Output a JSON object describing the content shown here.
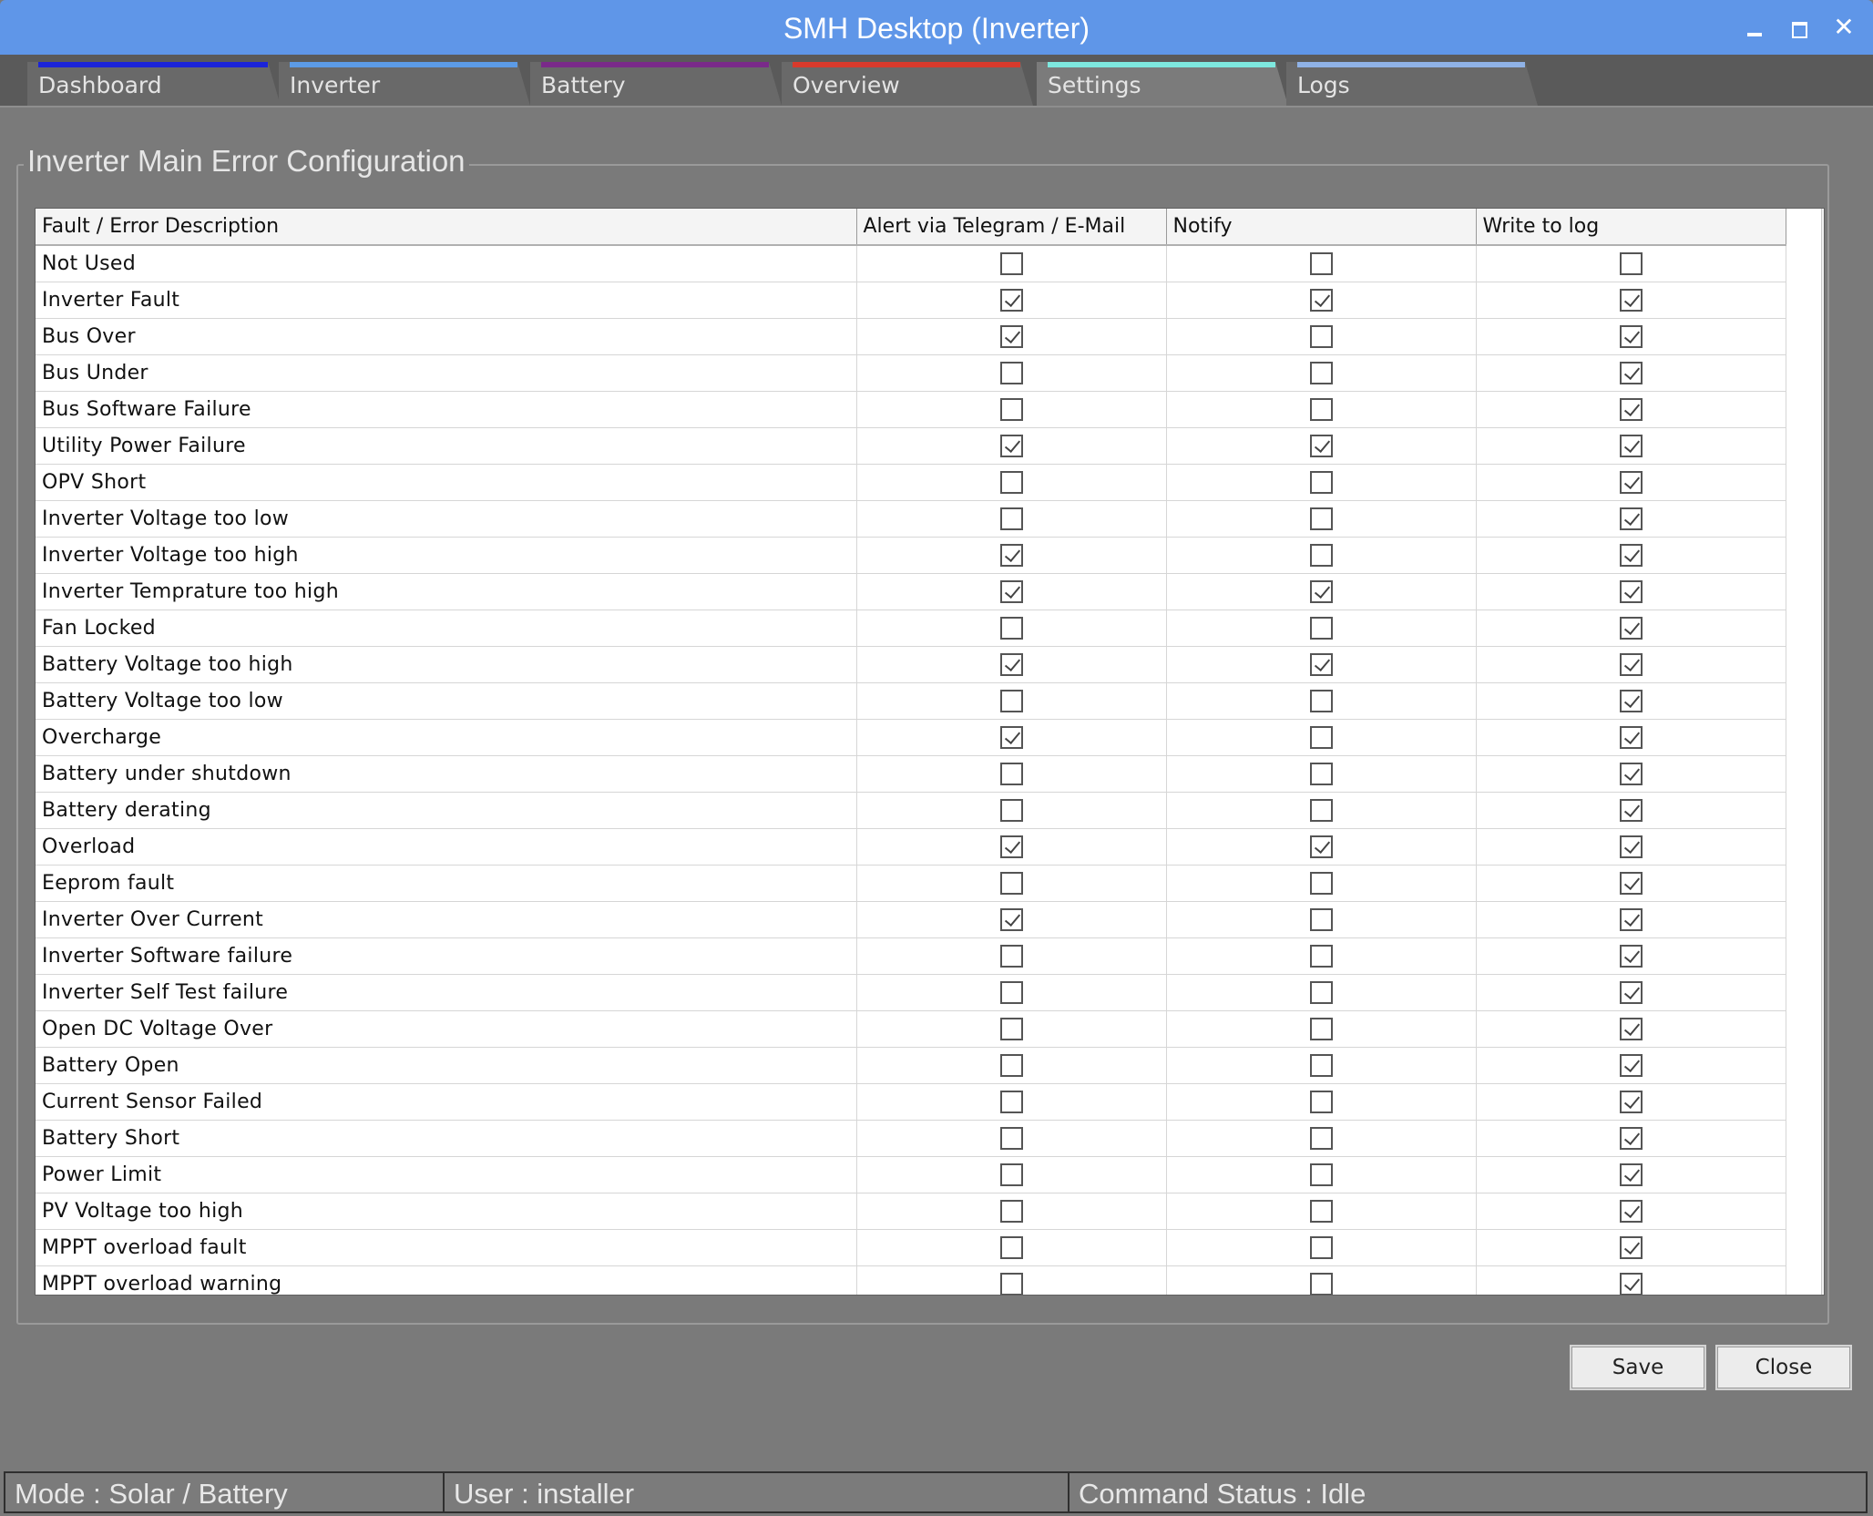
{
  "window": {
    "title": "SMH Desktop (Inverter)"
  },
  "tabs": [
    {
      "label": "Dashboard",
      "color": "#1b24d8",
      "active": false
    },
    {
      "label": "Inverter",
      "color": "#5c9be6",
      "active": false
    },
    {
      "label": "Battery",
      "color": "#7a2a8a",
      "active": false
    },
    {
      "label": "Overview",
      "color": "#d83a2c",
      "active": false
    },
    {
      "label": "Settings",
      "color": "#7ee8df",
      "active": true
    },
    {
      "label": "Logs",
      "color": "#8fb2e6",
      "active": false
    }
  ],
  "group": {
    "title": "Inverter Main Error Configuration"
  },
  "table": {
    "headers": [
      "Fault / Error Description",
      "Alert via Telegram / E-Mail",
      "Notify",
      "Write to log"
    ],
    "rows": [
      {
        "desc": "Not Used",
        "alert": false,
        "notify": false,
        "log": false
      },
      {
        "desc": "Inverter Fault",
        "alert": true,
        "notify": true,
        "log": true
      },
      {
        "desc": "Bus Over",
        "alert": true,
        "notify": false,
        "log": true
      },
      {
        "desc": "Bus Under",
        "alert": false,
        "notify": false,
        "log": true
      },
      {
        "desc": "Bus Software Failure",
        "alert": false,
        "notify": false,
        "log": true
      },
      {
        "desc": "Utility Power Failure",
        "alert": true,
        "notify": true,
        "log": true
      },
      {
        "desc": "OPV Short",
        "alert": false,
        "notify": false,
        "log": true
      },
      {
        "desc": "Inverter Voltage too low",
        "alert": false,
        "notify": false,
        "log": true
      },
      {
        "desc": "Inverter Voltage too high",
        "alert": true,
        "notify": false,
        "log": true
      },
      {
        "desc": "Inverter Temprature too high",
        "alert": true,
        "notify": true,
        "log": true
      },
      {
        "desc": "Fan Locked",
        "alert": false,
        "notify": false,
        "log": true
      },
      {
        "desc": "Battery Voltage too high",
        "alert": true,
        "notify": true,
        "log": true
      },
      {
        "desc": "Battery Voltage too low",
        "alert": false,
        "notify": false,
        "log": true
      },
      {
        "desc": "Overcharge",
        "alert": true,
        "notify": false,
        "log": true
      },
      {
        "desc": "Battery under shutdown",
        "alert": false,
        "notify": false,
        "log": true
      },
      {
        "desc": "Battery derating",
        "alert": false,
        "notify": false,
        "log": true
      },
      {
        "desc": "Overload",
        "alert": true,
        "notify": true,
        "log": true
      },
      {
        "desc": "Eeprom fault",
        "alert": false,
        "notify": false,
        "log": true
      },
      {
        "desc": "Inverter Over Current",
        "alert": true,
        "notify": false,
        "log": true
      },
      {
        "desc": "Inverter Software failure",
        "alert": false,
        "notify": false,
        "log": true
      },
      {
        "desc": "Inverter Self Test failure",
        "alert": false,
        "notify": false,
        "log": true
      },
      {
        "desc": "Open DC Voltage Over",
        "alert": false,
        "notify": false,
        "log": true
      },
      {
        "desc": "Battery Open",
        "alert": false,
        "notify": false,
        "log": true
      },
      {
        "desc": "Current Sensor Failed",
        "alert": false,
        "notify": false,
        "log": true
      },
      {
        "desc": "Battery Short",
        "alert": false,
        "notify": false,
        "log": true
      },
      {
        "desc": "Power Limit",
        "alert": false,
        "notify": false,
        "log": true
      },
      {
        "desc": "PV Voltage too high",
        "alert": false,
        "notify": false,
        "log": true
      },
      {
        "desc": "MPPT overload fault",
        "alert": false,
        "notify": false,
        "log": true
      },
      {
        "desc": "MPPT overload warning",
        "alert": false,
        "notify": false,
        "log": true
      }
    ]
  },
  "buttons": {
    "save": "Save",
    "close": "Close"
  },
  "status": {
    "mode": "Mode : Solar / Battery",
    "user": "User : installer",
    "command": "Command Status : Idle"
  },
  "icons": {
    "minimize": "minimize-icon",
    "maximize": "maximize-icon",
    "close": "close-icon"
  }
}
